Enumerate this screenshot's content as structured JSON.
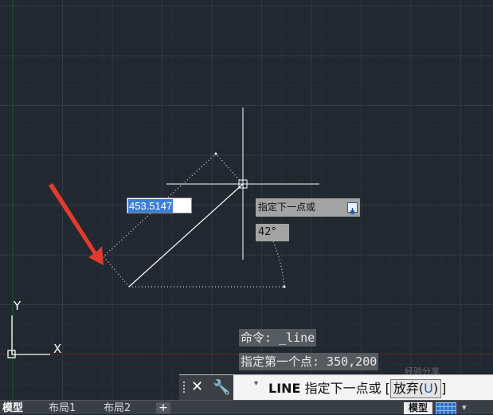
{
  "canvas": {
    "background": "#212830",
    "grid_minor_color": "#262d36",
    "grid_major_color": "#313a45",
    "x_axis_color": "#6b1f23",
    "y_axis_color": "#1f5a26"
  },
  "dynamic_input": {
    "length_value": "453.5147",
    "angle_value": "42°"
  },
  "tooltip": {
    "prompt": "指定下一点或",
    "menu_icon": "down-arrow-icon"
  },
  "ucs": {
    "y_label": "Y",
    "x_label": "X"
  },
  "command_history": [
    "命令: _line",
    "指定第一个点: 350,200"
  ],
  "command_line": {
    "close_icon": "✕",
    "settings_icon": "🔧",
    "dropdown_icon": "▾",
    "command": "LINE",
    "prompt": "指定下一点或",
    "option_prefix": "放弃(",
    "option_key": "U",
    "option_suffix": ")"
  },
  "layout_tabs": [
    "模型",
    "布局1",
    "布局2"
  ],
  "add_tab_label": "+",
  "status": {
    "model": "模型",
    "snap": "▾"
  },
  "watermark": "经验分享"
}
